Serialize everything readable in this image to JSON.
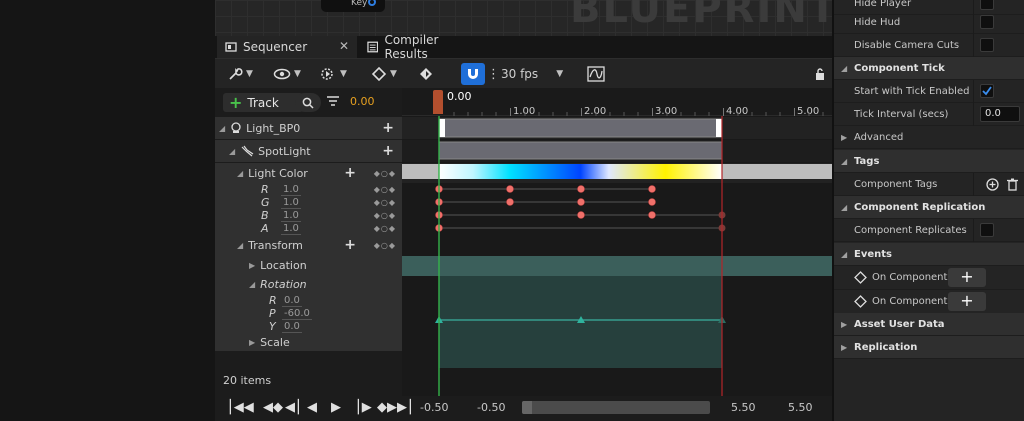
{
  "blueprint": {
    "watermark": "BLUEPRINT",
    "node_label": "Key"
  },
  "tabs": [
    {
      "label": "Sequencer",
      "active": true
    },
    {
      "label": "Compiler Results",
      "active": false
    }
  ],
  "toolbar": {
    "fps": "30 fps",
    "snap_active_color": "#1f6fd8"
  },
  "outliner": {
    "add_track_label": "Track",
    "current_time": "0.00",
    "items_count": "20 items",
    "rows": {
      "actor": "Light_BP0",
      "component": "SpotLight",
      "light_color": "Light Color",
      "r_label": "R",
      "r_value": "1.0",
      "g_label": "G",
      "g_value": "1.0",
      "b_label": "B",
      "b_value": "1.0",
      "a_label": "A",
      "a_value": "1.0",
      "transform": "Transform",
      "location": "Location",
      "rotation": "Rotation",
      "rot_r_label": "R",
      "rot_r_value": "0.0",
      "rot_p_label": "P",
      "rot_p_value": "-60.0",
      "rot_y_label": "Y",
      "rot_y_value": "0.0",
      "scale": "Scale"
    }
  },
  "timeline": {
    "playhead_label": "0.00",
    "ticks": [
      "1.00",
      "2.00",
      "3.00",
      "4.00",
      "5.00"
    ],
    "view_start": "-0.50",
    "work_start": "-0.50",
    "work_end": "5.50",
    "view_end": "5.50"
  },
  "details": {
    "hide_player": "Hide Player",
    "hide_hud": "Hide Hud",
    "disable_camera_cuts": "Disable Camera Cuts",
    "component_tick": "Component Tick",
    "start_with_tick": "Start with Tick Enabled",
    "tick_interval": "Tick Interval (secs)",
    "tick_interval_value": "0.0",
    "advanced": "Advanced",
    "tags": "Tags",
    "component_tags": "Component Tags",
    "component_replication": "Component Replication",
    "component_replicates": "Component Replicates",
    "events": "Events",
    "on_component_activated": "On Component Ac",
    "on_component_deactivated": "On Component De",
    "asset_user_data": "Asset User Data",
    "replication": "Replication"
  }
}
